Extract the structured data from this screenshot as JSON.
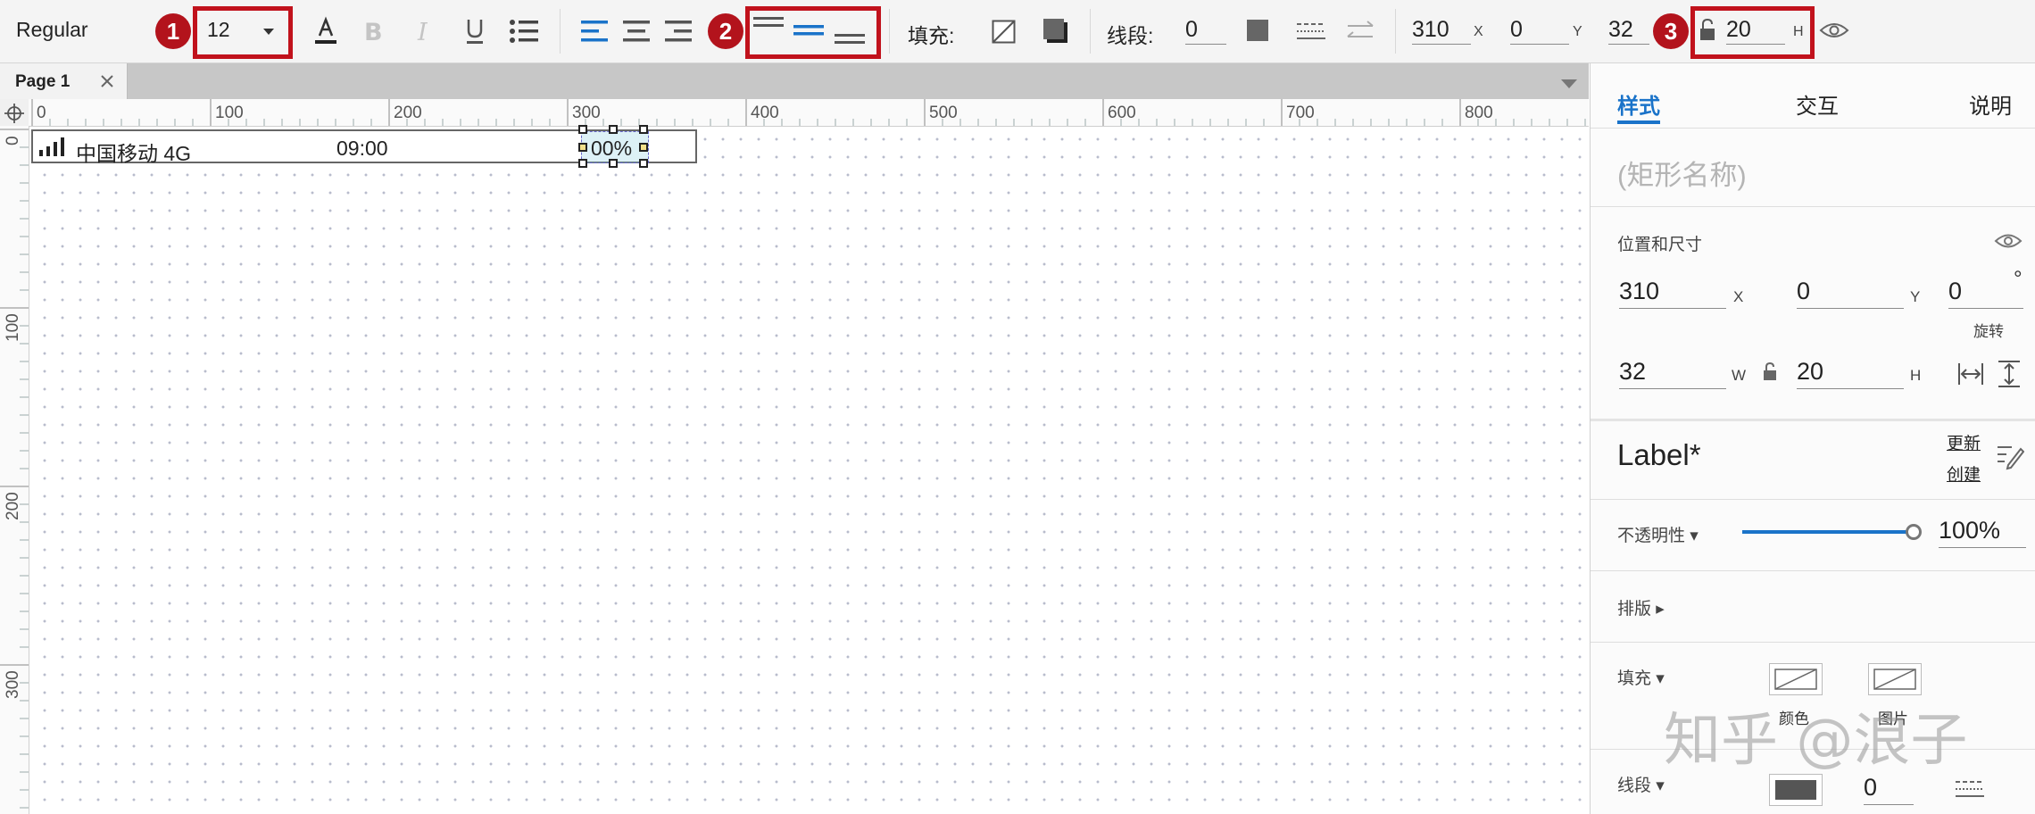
{
  "toolbar": {
    "font_weight": "Regular",
    "font_size": "12",
    "fill_label": "填充:",
    "line_label": "线段:",
    "line_width": "0",
    "x_value": "310",
    "x_unit": "X",
    "y_value": "0",
    "y_unit": "Y",
    "w_value": "32",
    "h_value": "20",
    "h_unit": "H",
    "markers": [
      "1",
      "2",
      "3"
    ]
  },
  "tab": {
    "label": "Page 1"
  },
  "ruler": {
    "h_labels": [
      "0",
      "100",
      "200",
      "300",
      "400",
      "500",
      "600",
      "700",
      "800"
    ],
    "v_labels": [
      "0",
      "100",
      "200",
      "300"
    ]
  },
  "canvas": {
    "carrier": "中国移动 4G",
    "time": "09:00",
    "battery": "00%"
  },
  "panel": {
    "tabs": [
      "样式",
      "交互",
      "说明"
    ],
    "shape_name_placeholder": "(矩形名称)",
    "position_size_label": "位置和尺寸",
    "x_value": "310",
    "x_unit": "X",
    "y_value": "0",
    "y_unit": "Y",
    "rotation_value": "0",
    "rotation_unit": "°",
    "rotation_label": "旋转",
    "w_value": "32",
    "w_unit": "W",
    "h_value": "20",
    "h_unit": "H",
    "style_name": "Label*",
    "update_link": "更新",
    "create_link": "创建",
    "opacity_label": "不透明性 ▾",
    "opacity_value": "100%",
    "opacity": 1.0,
    "layout_label": "排版 ▸",
    "fill_label": "填充 ▾",
    "fill_color_label": "颜色",
    "fill_image_label": "图片",
    "line_label": "线段 ▾",
    "line_width": "0"
  },
  "watermark": "知乎 @浪子",
  "colors": {
    "accent": "#1a73c9",
    "marker_red": "#b3131c",
    "fill_dark": "#555555"
  }
}
